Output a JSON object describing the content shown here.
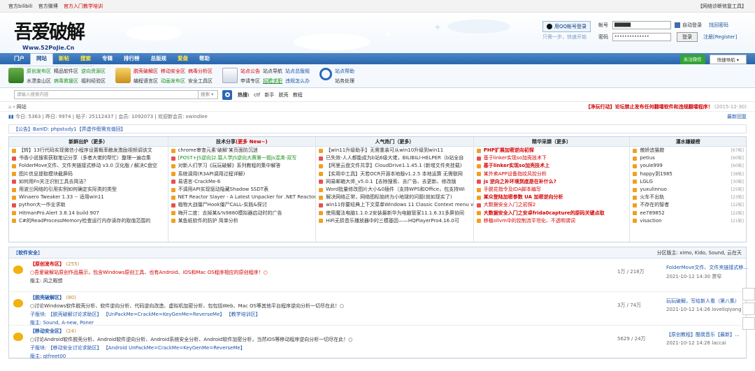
{
  "topbar": {
    "links": [
      "官方bilibili",
      "官方微博"
    ],
    "red_link": "官方入门教学培训",
    "right": "【网络诊断修复工具】"
  },
  "logo": {
    "main": "吾爱破解",
    "sub": "Www.52PoJie.Cn"
  },
  "qq": {
    "button": "用QQ帐号登录",
    "sub": "只需一步，快速开始"
  },
  "login": {
    "user_label": "帐号",
    "user_value": "▇▇▇▇▇",
    "pass_label": "密码",
    "pass_value": "••••••••••••••",
    "auto": "自动登录",
    "find": "找回密码",
    "btn": "登录",
    "register": "注册[Register]"
  },
  "nav": {
    "items": [
      {
        "label": "门户",
        "cls": ""
      },
      {
        "label": "网站",
        "cls": "act"
      },
      {
        "label": "新帖",
        "cls": "yel"
      },
      {
        "label": "搜索",
        "cls": "yel"
      },
      {
        "label": "专辑",
        "cls": ""
      },
      {
        "label": "排行榜",
        "cls": ""
      },
      {
        "label": "总版规",
        "cls": ""
      },
      {
        "label": "爱盘",
        "cls": "yel"
      },
      {
        "label": "帮助",
        "cls": ""
      }
    ],
    "wechat": "关注微信",
    "quick": "快捷导航 ▾"
  },
  "subnav": {
    "g1": {
      "r1": [
        "原创发布区",
        "精品软件区",
        "逆向资源区"
      ],
      "r2": [
        "水漂金山区",
        "病毒救援区",
        "福利经验区"
      ]
    },
    "g2": {
      "r1": [
        "脱壳破解区",
        "移动安全区",
        "病毒分析区"
      ],
      "r2": [
        "编程语言区",
        "动画发布区",
        "安全工具区"
      ]
    },
    "g3": {
      "r1": [
        "站点公告",
        "站点导航",
        "站点总版规"
      ],
      "r2": [
        "申请专区",
        "招聘求职",
        "违规怎么办"
      ]
    },
    "g4": {
      "r1": [
        "站点帮助"
      ],
      "r2": [
        "站务处理"
      ]
    }
  },
  "search": {
    "placeholder": "请输入搜索内容",
    "select": "搜索 ▾",
    "hot_label": "热搜:",
    "hot": [
      "ctf",
      "新手",
      "脱壳",
      "教程"
    ]
  },
  "crumb": {
    "home": "网站",
    "alert": "【净玩行动】论坛禁止发布任何翻墙软件和违规翻墙程序！",
    "date": "(2015-12-30)"
  },
  "stats": {
    "text": "今日: 5363 | 昨日: 9974 | 帖子: 25112437 | 会员: 1092073 | 欢迎新会员: xwindlee",
    "right": "最新回复"
  },
  "notice": {
    "text": "【公告】BanID: phpstudy1【弄虚作假需充值回】"
  },
  "table": {
    "c1": {
      "title": "新鲜出炉（更多）",
      "items": [
        "【转】13行代码实现微信小程序设置概率触发激励视频调该文",
        "书香小说搜索获取笔记分享（多者大佬的帮忙）整理一遍合集",
        "FolderMove文件、文件夹链接式移动 v3.0 汉化版 / 解决C盘空",
        "图片信息提取模块截屏码",
        "如何用Fn关注识别工具去简洁？",
        "用波兰网络的引用实例如何确定实际类的类型",
        "Winaero Tweaker 1.33 -- 适用win11",
        "python大一作业求助",
        "HitmanPro.Alert 3.8.14 build 907",
        "C#的ReadProcessMemory检查运行内存读存的取值范围的"
      ]
    },
    "c2": {
      "title": "技术分享",
      "title_hl": "(更多 New~)",
      "items": [
        "chrome审查元素'破解'某页面防沉迷",
        "[POST+JS逆向]2.猿人学JS逆向大赛第一题js混淆-双写",
        "对新人们学习《玩玩破解》系列教程的集中解答",
        "系统调用(R3API调用过程详解)",
        "易语言-CrackMe-6",
        "不调用API实现驱动隐藏Shadow SSDT表",
        "NET Reactor Slayer - A Latest Unpacker for .NET Reactor Lat",
        "植物大战僵尸Hook僵尸CALL-实践&探讨",
        "梅开二度：去掉某&%9880模拟器启动时的广告",
        "某鱼纸软件的防护 简单分析"
      ]
    },
    "c3": {
      "title": "人气热门（更多）",
      "items": [
        "【win11升级助手】无需重装可从win10升级到win11",
        "已失效-人人都能成为b站6级大佬，BILIBILI-HELPER（b站全自",
        "【阿里云盘文件共享】CloudDrive1.1.45.1 (新增文件夹挂载)",
        "【实用中工具】天若OCR开源本地版v1.2.5 本地运算 无需联网",
        "网易邮箱大师_v5.0.1【去除搜索、去广告、去更新、修改版",
        "Word批量修改图片大小&0插件（支持WPS和Office，包支持Wi",
        "解决网络正常，网络图标始终为小地球的问题(就如现实了)",
        "win11你要经典上下文菜单Windows 11 Classic Context menu v",
        "使用魔法电脑1.1.0.2安装最新华为电脑管家11.1.6.31多屏协同",
        "HiFi无损音乐播放器中的三模基因——HQPlayerPro4.16.0可"
      ]
    },
    "c4": {
      "title": "精华采撷（更多）",
      "items": [
        "PHP扩展加密逆向初探",
        "基于linker实现so加壳技术下",
        "基于linker实现so加壳技术上",
        "某外卖APP设备指纹风控分析",
        "js 逆向之补环境到底是在补什么?",
        "手脱花指令及IDA脚本编写",
        "某众登陆加密参数 UA 加密逆向分析",
        "大数据安全入门之初探2",
        "大数据安全入门之安卓frida0capture的原码关键点取",
        "移植ollvm中的控制流平坦化、不透明谓词"
      ]
    },
    "c5": {
      "title": "灌水嫌疑榜",
      "items": [
        "傲娇追猫貌",
        "petius",
        "youle999",
        "happy到1985",
        "LGLG",
        "yuxulinnuo",
        "火车不出轨",
        "不存在的智者",
        "ee789852",
        "visaction"
      ],
      "counts": [
        "[67帖]",
        "[60帖]",
        "[60帖]",
        "[38帖]",
        "[30帖]",
        "[25帖]",
        "[23帖]",
        "[22帖]",
        "[22帖]",
        "[21帖]"
      ]
    }
  },
  "forum": {
    "title": "软件安全",
    "mods": "分区版主: ximo, Kido, Sound, 云在天",
    "rows": [
      {
        "title": "【原创发布区】",
        "count": "(255)",
        "desc": "○吾爱破解站原创作品展示，包含Windows原创工具、也有Android、iOS和Mac OS程序相应的原创程序！○",
        "meta": "版主: 风之暇想",
        "stat": "1万 / 218万",
        "last": "FolderMove文件、文件夹链接式移...",
        "time": "2021-10-12 14:30 萧窄"
      },
      {
        "title": "【脱壳破解区】",
        "count": "(80)",
        "desc": "○讨论Windows软件脱壳分析、软件逆向分析、代码逆向改造、虚拟机加密分析、包包括Web、Mac OS等其他平台程序逆向分析一切尽在此！○",
        "meta": "子版块: 【脱壳破解讨论求助区】 【UnPackMe=CrackMe=KeyGenMe=ReverseMe】 【教学培训区】",
        "meta2": "版主: Sound, A-new, Poner",
        "stat": "3万 / 74万",
        "last": "玩玩破解，写给新人看（第八集）",
        "time": "2021-10-12 14:26 loveliqiyong"
      },
      {
        "title": "【移动安全区】",
        "count": "(24)",
        "desc": "○讨论Android软件脱壳分析、Android软件逆向分析、Android系统安全分析、Android软件加密分析，当然iOS等移动程序逆向分析一切尽在此！○",
        "meta": "子版块: 【移动安全讨论求助区】 【Android UnPackMe=CrackMe=KeyGenMe=ReverseMe】",
        "meta2": "版主: qtfreet00",
        "stat": "5629 / 24万",
        "last": "【原创教程】酷我音乐【最新】...",
        "time": "2021-10-12 14:26 laccai"
      }
    ]
  }
}
